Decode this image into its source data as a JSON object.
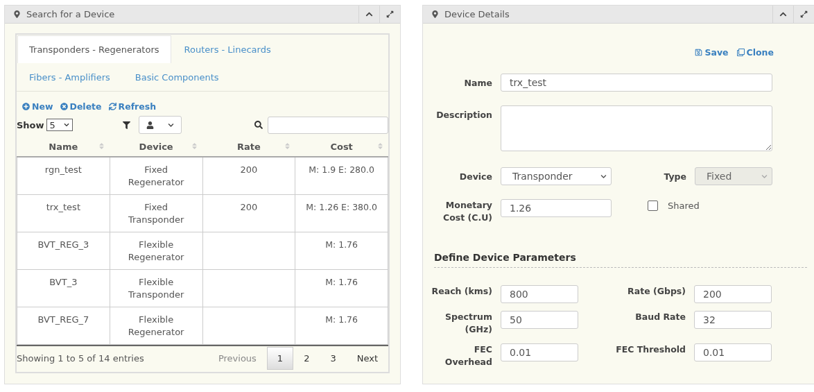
{
  "search_panel": {
    "title": "Search for a Device",
    "tabs": [
      {
        "label": "Transponders - Regenerators",
        "selected": true
      },
      {
        "label": "Routers - Linecards",
        "selected": false
      },
      {
        "label": "Fibers - Amplifiers",
        "selected": false
      },
      {
        "label": "Basic Components",
        "selected": false
      }
    ],
    "actions": [
      {
        "label": "New",
        "kind": "new"
      },
      {
        "label": "Delete",
        "kind": "delete"
      },
      {
        "label": "Refresh",
        "kind": "refresh"
      }
    ],
    "show_label": "Show",
    "page_size": "5",
    "table": {
      "columns": [
        "Name",
        "Device",
        "Rate",
        "Cost"
      ],
      "rows": [
        {
          "name": "rgn_test",
          "device": "Fixed Regenerator",
          "rate": "200",
          "cost": "M: 1.9 E: 280.0"
        },
        {
          "name": "trx_test",
          "device": "Fixed Transponder",
          "rate": "200",
          "cost": "M: 1.26 E: 380.0"
        },
        {
          "name": "BVT_REG_3",
          "device": "Flexible Regenerator",
          "cost": "M: 1.76"
        },
        {
          "name": "BVT_3",
          "device": "Flexible Transponder",
          "cost": "M: 1.76"
        },
        {
          "name": "BVT_REG_7",
          "device": "Flexible Regenerator",
          "cost": "M: 1.76"
        }
      ]
    },
    "info": "Showing 1 to 5 of 14 entries",
    "pagination": [
      {
        "label": "Previous",
        "selected": false,
        "disabled": true
      },
      {
        "label": "1",
        "selected": true,
        "disabled": false
      },
      {
        "label": "2",
        "selected": false,
        "disabled": false
      },
      {
        "label": "3",
        "selected": false,
        "disabled": false
      },
      {
        "label": "Next",
        "selected": false,
        "disabled": false
      }
    ]
  },
  "details_panel": {
    "title": "Device Details",
    "actions": [
      {
        "label": "Save",
        "kind": "save"
      },
      {
        "label": "Clone",
        "kind": "clone"
      }
    ],
    "name": {
      "label": "Name",
      "value": "trx_test"
    },
    "description": {
      "label": "Description"
    },
    "device": {
      "label": "Device",
      "value": "Transponder"
    },
    "type": {
      "label": "Type",
      "value": "Fixed",
      "disabled": true
    },
    "monetary_cost": {
      "label": "Monetary Cost (C.U)",
      "value": "1.26"
    },
    "shared": {
      "label": "Shared",
      "checked": false
    },
    "section_title": "Define Device Parameters",
    "parameters": [
      {
        "label": "Reach (kms)",
        "value": "800"
      },
      {
        "label": "Rate (Gbps)",
        "value": "200"
      },
      {
        "label": "Spectrum (GHz)",
        "value": "50"
      },
      {
        "label": "Baud Rate",
        "value": "32"
      },
      {
        "label": "FEC Overhead",
        "value": "0.01"
      },
      {
        "label": "FEC Threshold",
        "value": "0.01"
      }
    ]
  }
}
